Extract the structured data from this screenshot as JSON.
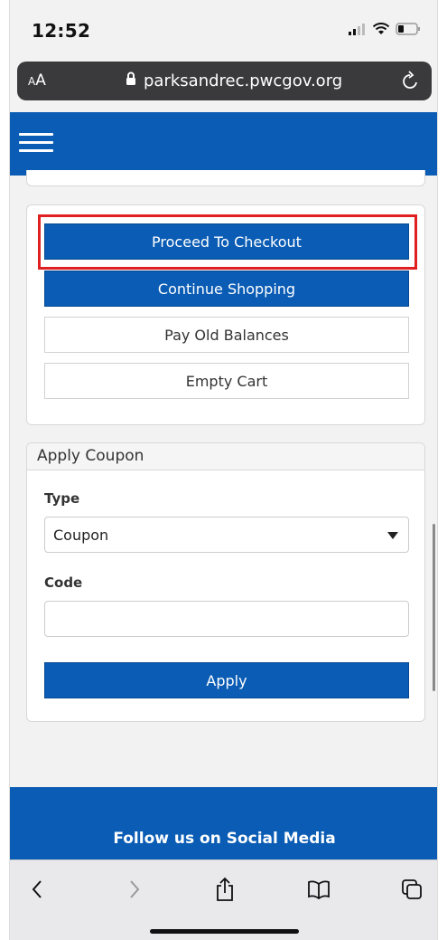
{
  "status": {
    "time": "12:52"
  },
  "browser": {
    "aa_small": "A",
    "aa_large": "A",
    "url": "parksandrec.pwcgov.org"
  },
  "cart": {
    "checkout_label": "Proceed To Checkout",
    "continue_label": "Continue Shopping",
    "pay_old_label": "Pay Old Balances",
    "empty_label": "Empty Cart"
  },
  "coupon": {
    "title": "Apply Coupon",
    "type_label": "Type",
    "type_value": "Coupon",
    "code_label": "Code",
    "code_value": "",
    "apply_label": "Apply"
  },
  "footer": {
    "follow_label": "Follow us on Social Media"
  },
  "colors": {
    "brand_blue": "#0a5cb4",
    "highlight_red": "#e02020"
  },
  "icons": [
    "signal-icon",
    "wifi-icon",
    "battery-icon",
    "lock-icon",
    "reload-icon",
    "hamburger-menu-icon",
    "back-icon",
    "forward-icon",
    "share-icon",
    "bookmarks-icon",
    "tabs-icon"
  ]
}
